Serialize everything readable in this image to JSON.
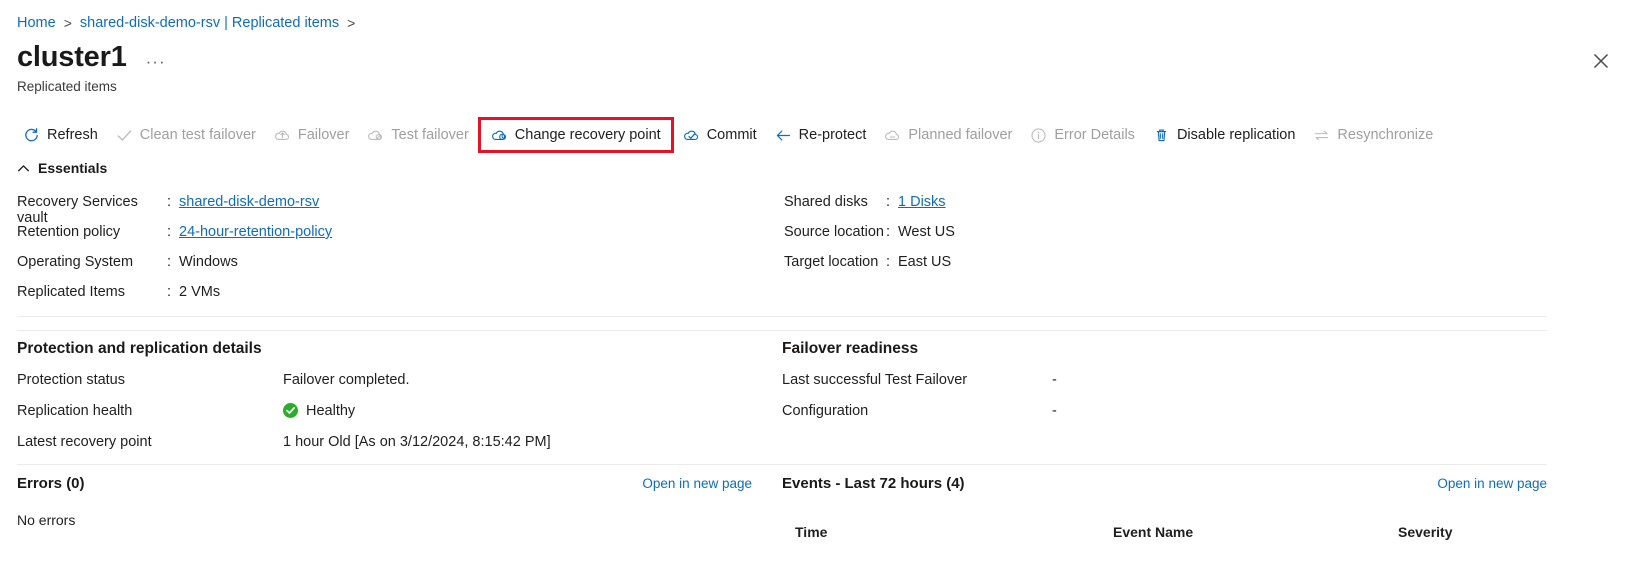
{
  "breadcrumb": {
    "items": [
      {
        "label": "Home",
        "link": true
      },
      {
        "label": "shared-disk-demo-rsv | Replicated items",
        "link": true
      }
    ],
    "separator": ">"
  },
  "header": {
    "title": "cluster1",
    "ellipsis": "···",
    "subtitle": "Replicated items",
    "close_icon": "close-icon"
  },
  "commandbar": {
    "items": [
      {
        "label": "Refresh",
        "icon": "refresh-icon",
        "disabled": false,
        "highlighted": false
      },
      {
        "label": "Clean test failover",
        "icon": "checkmark-icon",
        "disabled": true,
        "highlighted": false
      },
      {
        "label": "Failover",
        "icon": "failover-cloud-icon",
        "disabled": true,
        "highlighted": false
      },
      {
        "label": "Test failover",
        "icon": "test-failover-cloud-icon",
        "disabled": true,
        "highlighted": false
      },
      {
        "label": "Change recovery point",
        "icon": "change-recovery-point-cloud-icon",
        "disabled": false,
        "highlighted": true
      },
      {
        "label": "Commit",
        "icon": "commit-cloud-icon",
        "disabled": false,
        "highlighted": false
      },
      {
        "label": "Re-protect",
        "icon": "arrow-left-icon",
        "disabled": false,
        "highlighted": false
      },
      {
        "label": "Planned failover",
        "icon": "planned-failover-cloud-icon",
        "disabled": true,
        "highlighted": false
      },
      {
        "label": "Error Details",
        "icon": "info-icon",
        "disabled": true,
        "highlighted": false
      },
      {
        "label": "Disable replication",
        "icon": "trash-icon",
        "disabled": false,
        "highlighted": false
      },
      {
        "label": "Resynchronize",
        "icon": "resync-arrows-icon",
        "disabled": true,
        "highlighted": false
      }
    ],
    "highlight_color": "#e81123"
  },
  "essentials": {
    "heading": "Essentials",
    "chevron": "chevron-up-icon",
    "left": [
      {
        "key": "Recovery Services vault",
        "colon": ":",
        "value": "shared-disk-demo-rsv",
        "link": true
      },
      {
        "key": "Retention policy",
        "colon": ":",
        "value": "24-hour-retention-policy",
        "link": true
      },
      {
        "key": "Operating System",
        "colon": ":",
        "value": "Windows",
        "link": false
      },
      {
        "key": "Replicated Items",
        "colon": ":",
        "value": "2 VMs",
        "link": false
      }
    ],
    "right": [
      {
        "key": "Shared disks",
        "colon": ":",
        "value": "1 Disks",
        "link": true
      },
      {
        "key": "Source location",
        "colon": ":",
        "value": "West US",
        "link": false
      },
      {
        "key": "Target location",
        "colon": ":",
        "value": "East US",
        "link": false
      }
    ]
  },
  "protection": {
    "title": "Protection and replication details",
    "rows": [
      {
        "key": "Protection status",
        "value": "Failover completed.",
        "badge": null
      },
      {
        "key": "Replication health",
        "value": "Healthy",
        "badge": "healthy-check-icon",
        "badge_color": "#2bad2b"
      },
      {
        "key": "Latest recovery point",
        "value": "1 hour Old [As on 3/12/2024, 8:15:42 PM]",
        "badge": null
      }
    ]
  },
  "failover_readiness": {
    "title": "Failover readiness",
    "rows": [
      {
        "key": "Last successful Test Failover",
        "value": "-"
      },
      {
        "key": "Configuration",
        "value": "-"
      }
    ]
  },
  "errors_panel": {
    "title": "Errors (0)",
    "open_link": "Open in new page",
    "empty_text": "No errors"
  },
  "events_panel": {
    "title": "Events - Last 72 hours (4)",
    "open_link": "Open in new page",
    "columns": [
      "Time",
      "Event Name",
      "Severity"
    ],
    "rows": []
  },
  "colors": {
    "link": "#0f6cbd",
    "text": "#201f1e",
    "disabled": "#a19f9d",
    "accent_red": "#e81123",
    "healthy_green": "#2bad2b"
  }
}
